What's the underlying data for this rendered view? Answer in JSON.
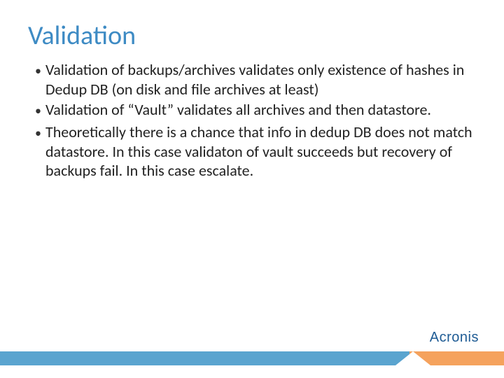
{
  "title": "Validation",
  "bullets": [
    "Validation of backups/archives validates only existence of hashes in Dedup DB (on disk and file archives at least)",
    "Validation of “Vault” validates all archives and then datastore.",
    "Theoretically there is a chance that info in dedup DB does not match datastore. In this case validaton of vault succeeds but recovery of backups fail. In this case escalate."
  ],
  "logo": "Acronis"
}
